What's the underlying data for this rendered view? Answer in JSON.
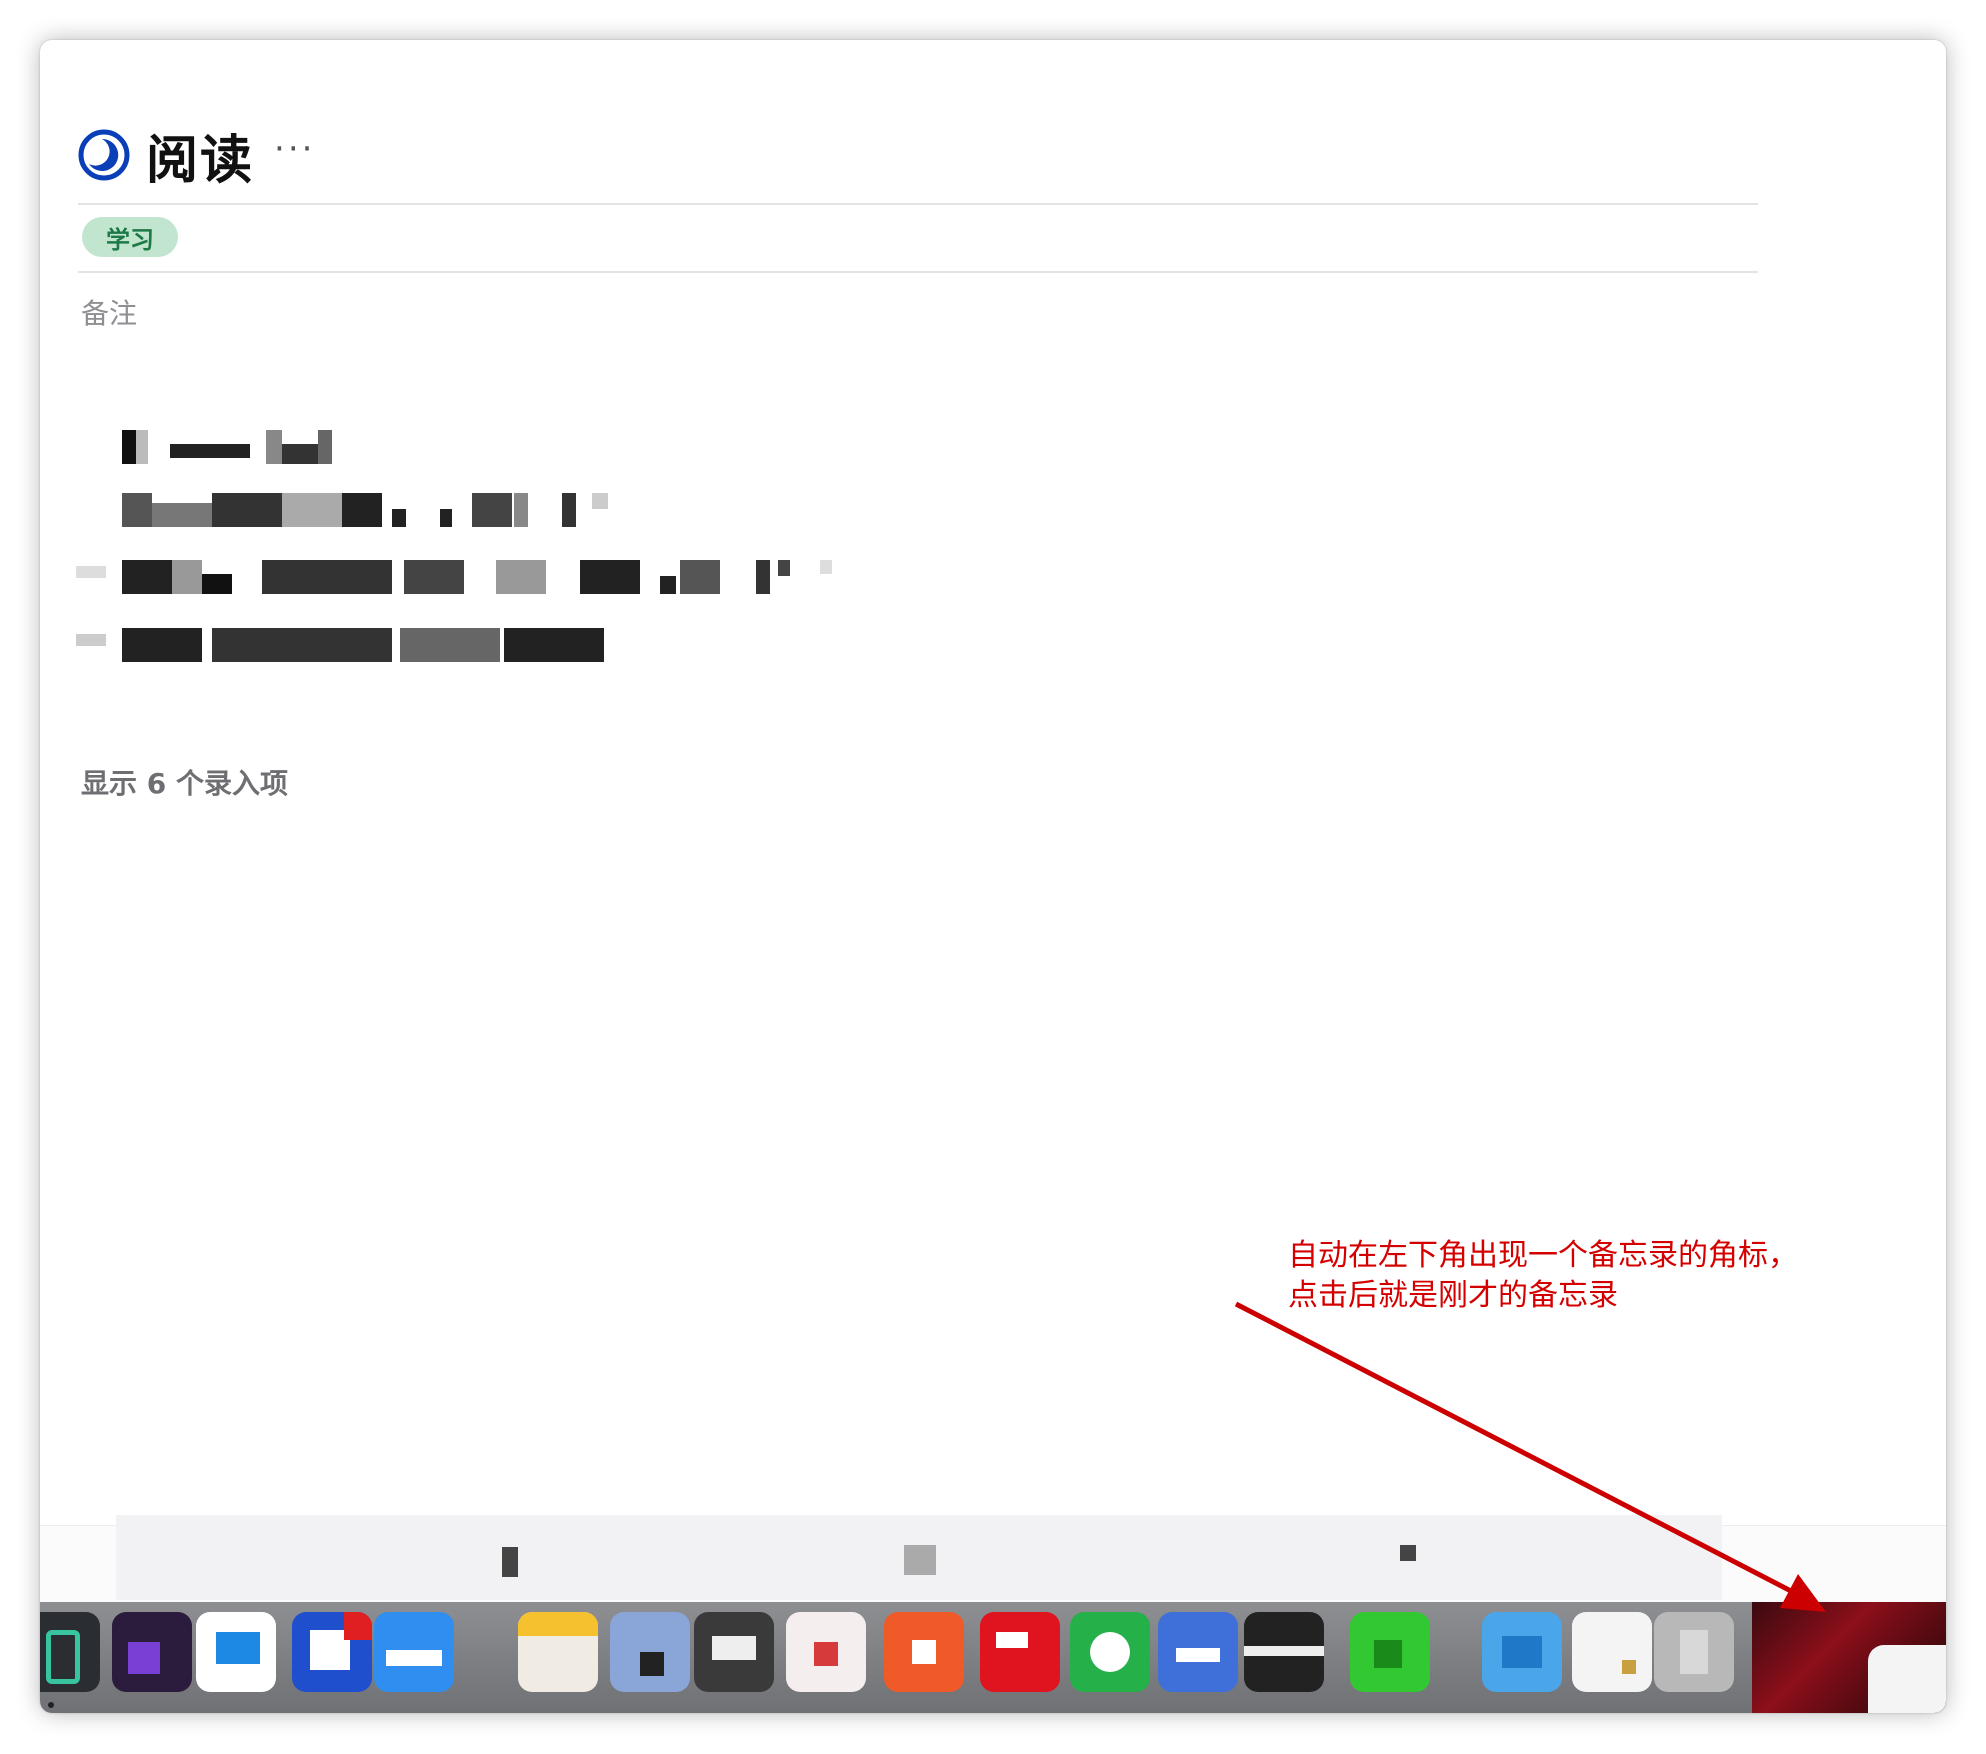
{
  "page": {
    "title": "阅读",
    "more_menu": "···",
    "tag": "学习",
    "notes_label": "备注",
    "show_entries": "显示 6 个录入项"
  },
  "annotation": {
    "line1": "自动在左下角出现一个备忘录的角标，",
    "line2": "点击后就是刚才的备忘录"
  },
  "colors": {
    "accent": "#0a3fb8",
    "tag_bg": "#c2e5d0",
    "tag_text": "#1d7a47",
    "annotation": "#d40000"
  },
  "icons": {
    "app": "moon-circle-icon",
    "more": "ellipsis-icon",
    "arrow": "annotation-arrow"
  }
}
